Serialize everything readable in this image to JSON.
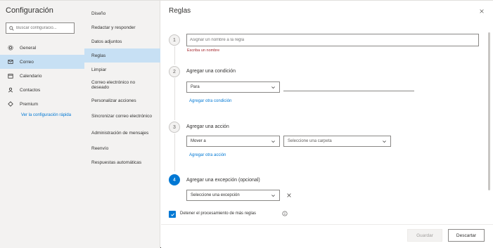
{
  "app": {
    "title": "Configuración"
  },
  "search": {
    "placeholder": "Buscar configuracio..."
  },
  "nav": {
    "items": [
      {
        "label": "General",
        "icon": "gear-icon",
        "selected": false
      },
      {
        "label": "Correo",
        "icon": "mail-icon",
        "selected": true
      },
      {
        "label": "Calendario",
        "icon": "calendar-icon",
        "selected": false
      },
      {
        "label": "Contactos",
        "icon": "people-icon",
        "selected": false
      },
      {
        "label": "Premium",
        "icon": "diamond-icon",
        "selected": false
      }
    ],
    "quick_link": "Ver la configuración rápida"
  },
  "subnav": {
    "items": [
      {
        "label": "Diseño"
      },
      {
        "label": "Redactar y responder"
      },
      {
        "label": "Datos adjuntos"
      },
      {
        "label": "Reglas",
        "selected": true
      },
      {
        "label": "Limpiar"
      },
      {
        "label": "Correo electrónico no deseado"
      },
      {
        "label": "Personalizar acciones"
      },
      {
        "label": "Sincronizar correo electrónico"
      },
      {
        "label": "Administración de mensajes"
      },
      {
        "label": "Reenvío"
      },
      {
        "label": "Respuestas automáticas"
      }
    ]
  },
  "main": {
    "title": "Reglas",
    "step1": {
      "num": "1",
      "placeholder": "Asignar un nombre a la regla",
      "error": "Escriba un nombre"
    },
    "step2": {
      "num": "2",
      "label": "Agregar una condición",
      "select_value": "Para",
      "add_link": "Agregar otra condición"
    },
    "step3": {
      "num": "3",
      "label": "Agregar una acción",
      "select_value": "Mover a",
      "select2_value": "Seleccione una carpeta",
      "add_link": "Agregar otra acción"
    },
    "step4": {
      "num": "4",
      "label": "Agregar una excepción (opcional)",
      "select_value": "Seleccione una excepción"
    },
    "checkbox_label": "Detener el procesamiento de más reglas",
    "checkbox_checked": true,
    "buttons": {
      "save": "Guardar",
      "discard": "Descartar"
    }
  },
  "colors": {
    "accent": "#0078d4",
    "error": "#a4262c",
    "selected_bg": "#c7e0f4"
  }
}
